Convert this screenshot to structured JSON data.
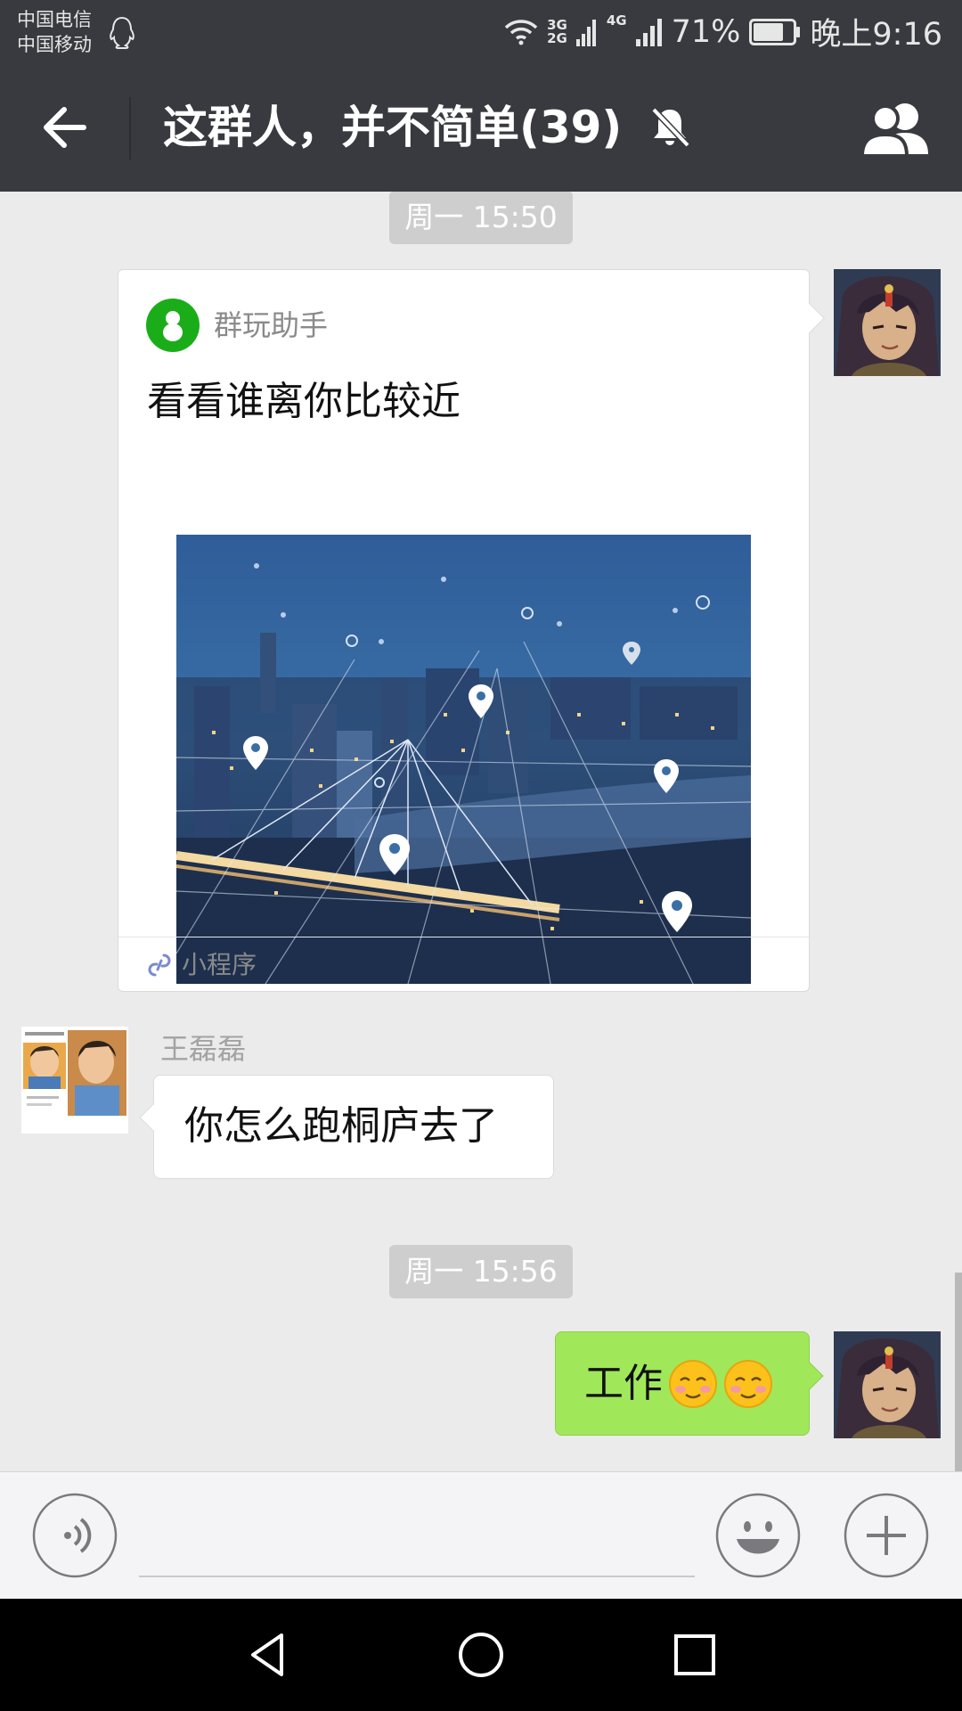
{
  "status_bar": {
    "carrier_1": "中国电信",
    "carrier_2": "中国移动",
    "network_top": "3G",
    "network_bottom": "2G",
    "network_4g": "4G",
    "battery": "71%",
    "time": "晚上9:16"
  },
  "header": {
    "title": "这群人，并不简单(39)",
    "muted": true
  },
  "messages": {
    "timestamp_1": "周一 15:50",
    "card": {
      "app_name": "群玩助手",
      "title": "看看谁离你比较近",
      "footer_label": "小程序"
    },
    "incoming": {
      "sender": "王磊磊",
      "text": "你怎么跑桐庐去了"
    },
    "timestamp_2": "周一 15:56",
    "outgoing": {
      "text": "工作",
      "emoji_count": 2
    }
  },
  "icons": {
    "back": "back-arrow-icon",
    "mute": "bell-off-icon",
    "members": "group-members-icon",
    "voice": "voice-icon",
    "emoji": "emoji-smile-icon",
    "plus": "plus-icon",
    "link": "link-icon"
  },
  "colors": {
    "header_bg": "#393a3f",
    "chat_bg": "#ebebeb",
    "outgoing_bubble": "#a0e75a",
    "miniprogram_green": "#1aad19"
  }
}
